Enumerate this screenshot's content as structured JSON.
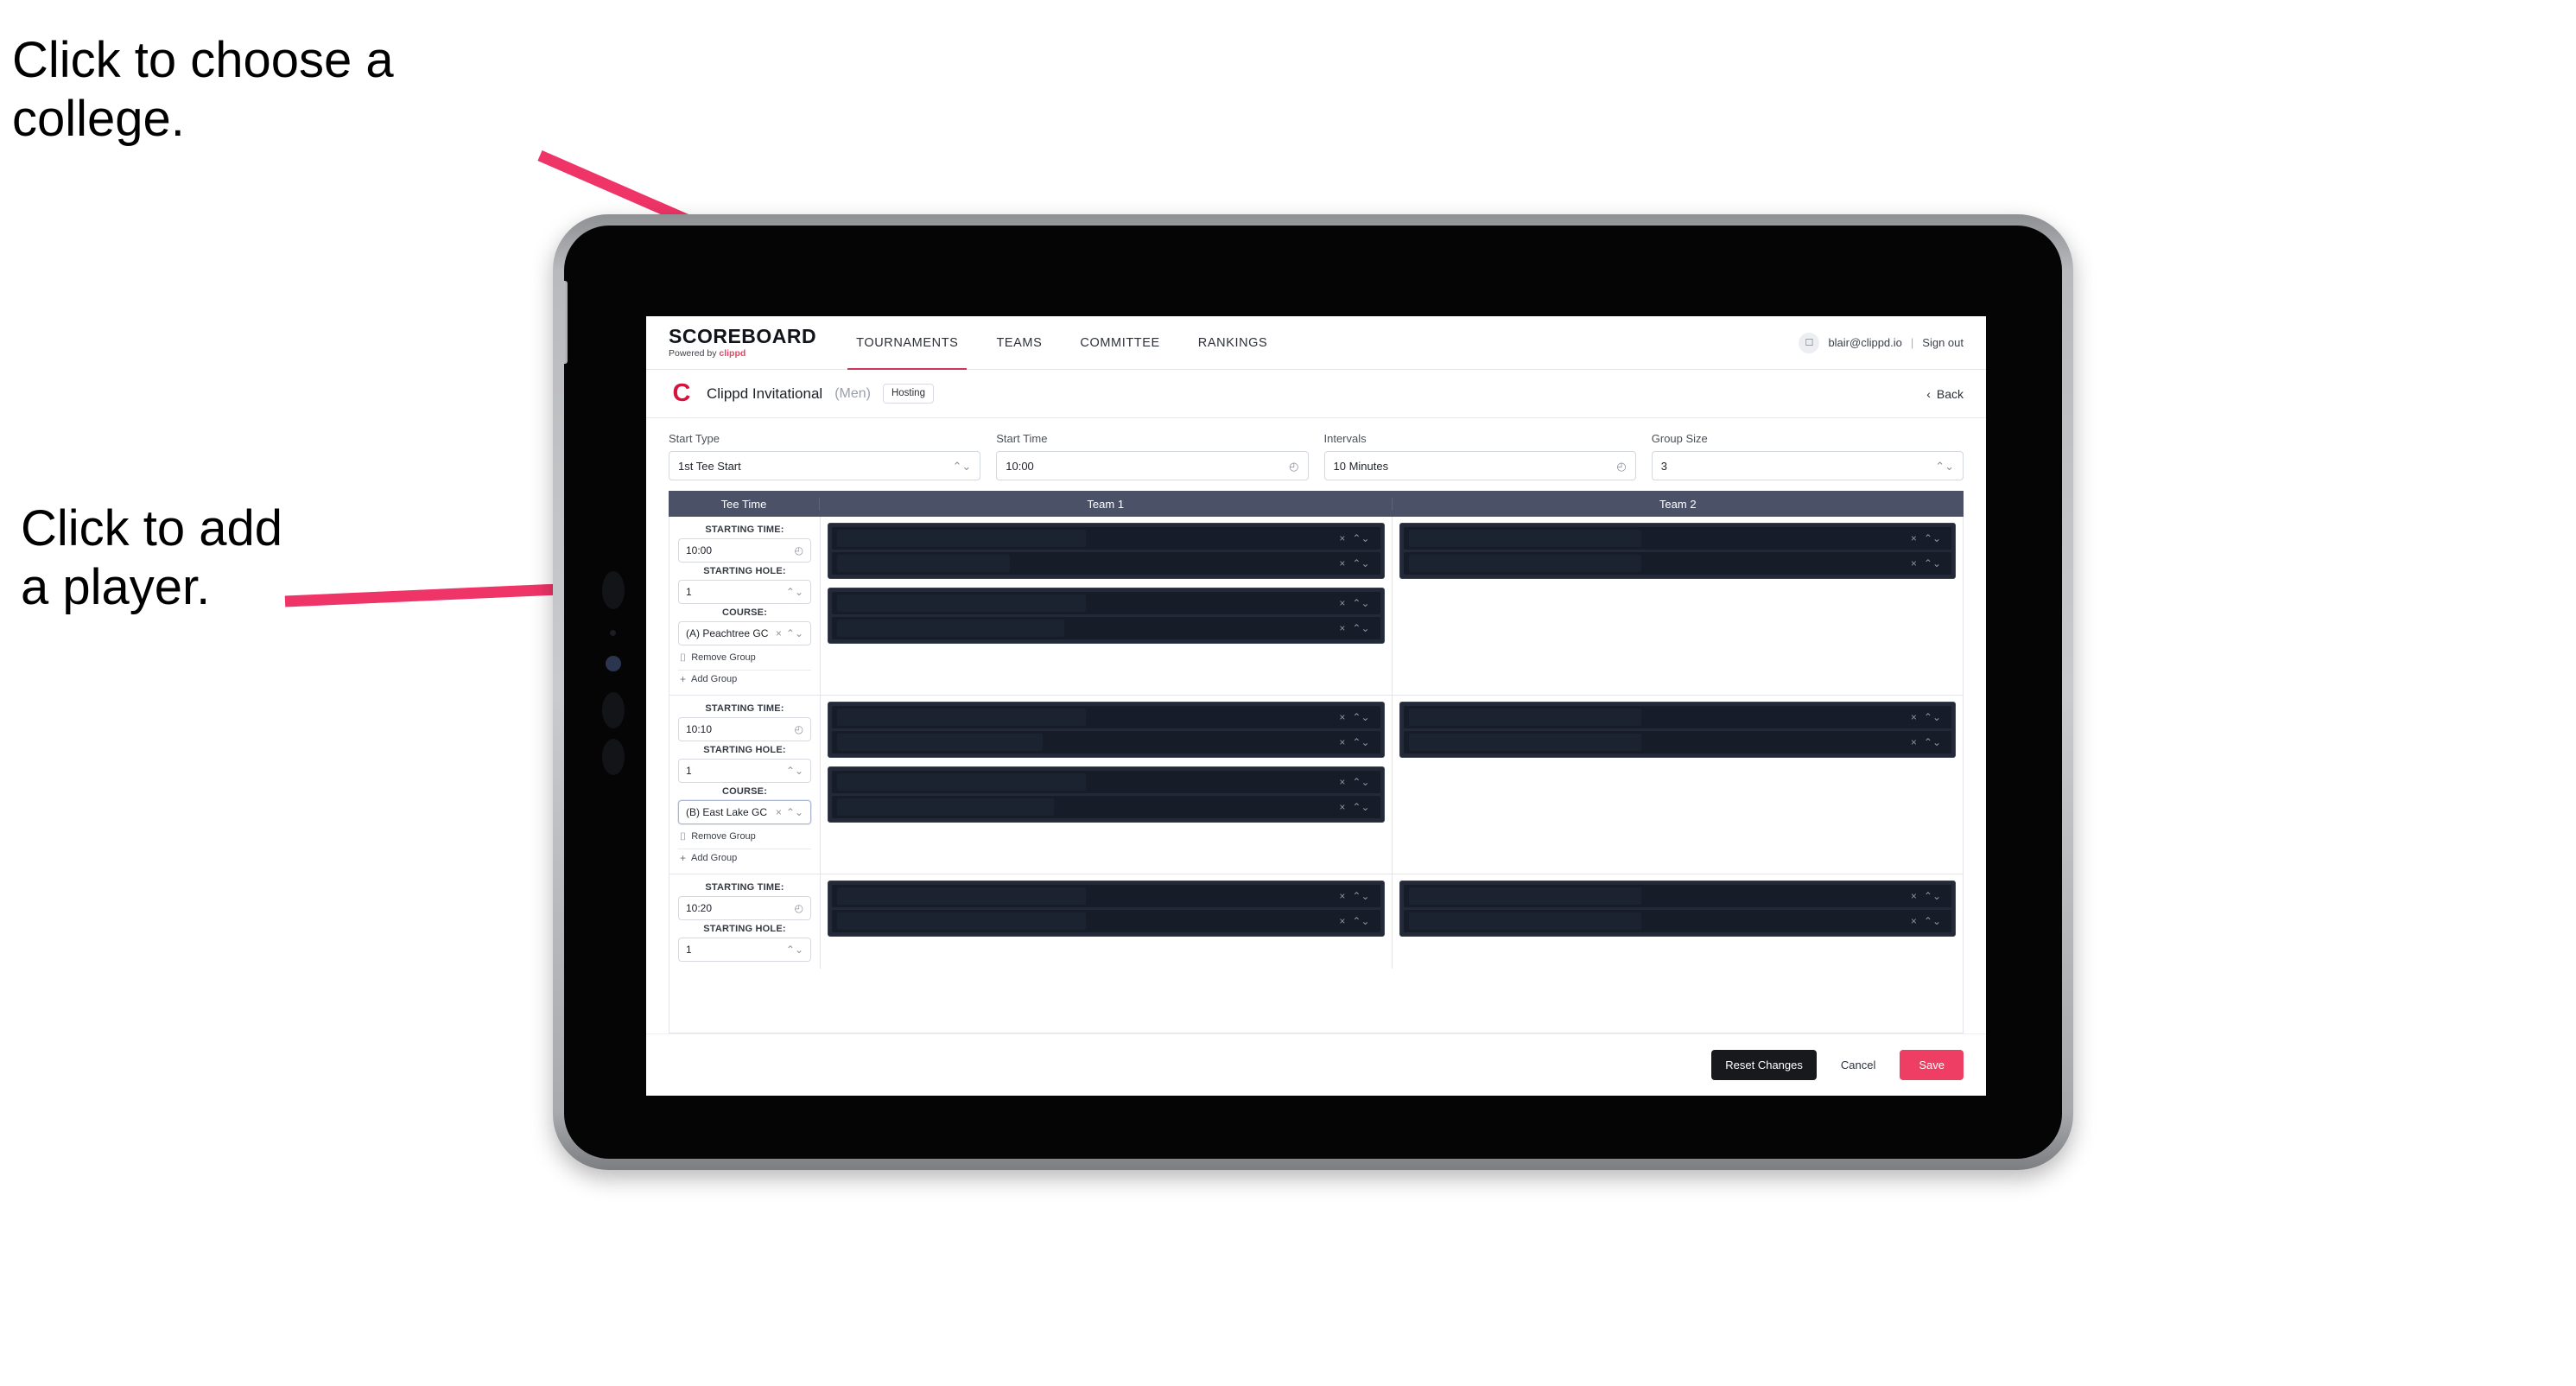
{
  "annotations": [
    {
      "id": "choose-college",
      "text": "Click to choose a\ncollege."
    },
    {
      "id": "add-player",
      "text": "Click to add\na player."
    }
  ],
  "colors": {
    "accent_pink": "#ef3e63",
    "brand_red": "#d4143f",
    "table_header": "#4b5268",
    "dark_row": "#161c28",
    "arrow": "#ef3468"
  },
  "nav": {
    "brand_title": "SCOREBOARD",
    "brand_sub_prefix": "Powered by",
    "brand_sub_accent": "clippd",
    "tabs": [
      {
        "label": "TOURNAMENTS",
        "active": true
      },
      {
        "label": "TEAMS",
        "active": false
      },
      {
        "label": "COMMITTEE",
        "active": false
      },
      {
        "label": "RANKINGS",
        "active": false
      }
    ],
    "avatar_icon": "user-avatar-icon",
    "user_email": "blair@clippd.io",
    "separator": "|",
    "sign_out": "Sign out"
  },
  "tournament": {
    "logo_letter": "C",
    "name": "Clippd Invitational",
    "gender": "(Men)",
    "badge": "Hosting",
    "back_chevron": "‹",
    "back_label": "Back"
  },
  "controls": [
    {
      "label": "Start Type",
      "value": "1st Tee Start",
      "icon": "stepper-icon",
      "glyph": "⌃⌄"
    },
    {
      "label": "Start Time",
      "value": "10:00",
      "icon": "clock-icon",
      "glyph": "◴"
    },
    {
      "label": "Intervals",
      "value": "10 Minutes",
      "icon": "clock-icon",
      "glyph": "◴"
    },
    {
      "label": "Group Size",
      "value": "3",
      "icon": "stepper-icon",
      "glyph": "⌃⌄"
    }
  ],
  "table": {
    "headers": {
      "tee_time": "Tee Time",
      "team1": "Team 1",
      "team2": "Team 2"
    },
    "field_labels": {
      "starting_time": "STARTING TIME:",
      "starting_hole": "STARTING HOLE:",
      "course": "COURSE:"
    },
    "actions": {
      "remove_group": "Remove Group",
      "remove_icon": "trash-icon",
      "remove_glyph": "⌷",
      "add_group": "Add Group",
      "add_icon": "plus-icon",
      "add_glyph": "+"
    },
    "icons": {
      "clock": "clock-icon",
      "clock_glyph": "◴",
      "stepper": "stepper-icon",
      "stepper_glyph": "⌃⌄",
      "clear": "clear-x-icon",
      "clear_glyph": "×"
    },
    "rows": [
      {
        "starting_time": "10:00",
        "starting_hole": "1",
        "course": "(A) Peachtree GC",
        "course_focused": false,
        "show_hole": true,
        "show_course": true,
        "show_group_actions": true,
        "team1_groups": [
          {
            "players": [
              {
                "redact_pct": 46
              },
              {
                "redact_pct": 32
              }
            ]
          },
          {
            "players": [
              {
                "redact_pct": 46
              },
              {
                "redact_pct": 42
              }
            ]
          }
        ],
        "team2_groups": [
          {
            "players": [
              {
                "redact_pct": 43
              },
              {
                "redact_pct": 43
              }
            ]
          }
        ]
      },
      {
        "starting_time": "10:10",
        "starting_hole": "1",
        "course": "(B) East Lake GC",
        "course_focused": true,
        "show_hole": true,
        "show_course": true,
        "show_group_actions": true,
        "team1_groups": [
          {
            "players": [
              {
                "redact_pct": 46
              },
              {
                "redact_pct": 38
              }
            ]
          },
          {
            "players": [
              {
                "redact_pct": 46
              },
              {
                "redact_pct": 40
              }
            ]
          }
        ],
        "team2_groups": [
          {
            "players": [
              {
                "redact_pct": 43
              },
              {
                "redact_pct": 43
              }
            ]
          }
        ]
      },
      {
        "starting_time": "10:20",
        "starting_hole": "1",
        "course": "",
        "course_focused": false,
        "show_hole": true,
        "show_course": false,
        "show_group_actions": false,
        "team1_groups": [
          {
            "players": [
              {
                "redact_pct": 46
              },
              {
                "redact_pct": 46
              }
            ]
          }
        ],
        "team2_groups": [
          {
            "players": [
              {
                "redact_pct": 43
              },
              {
                "redact_pct": 43
              }
            ]
          }
        ]
      }
    ]
  },
  "footer": {
    "reset_label": "Reset Changes",
    "cancel_label": "Cancel",
    "save_label": "Save"
  }
}
